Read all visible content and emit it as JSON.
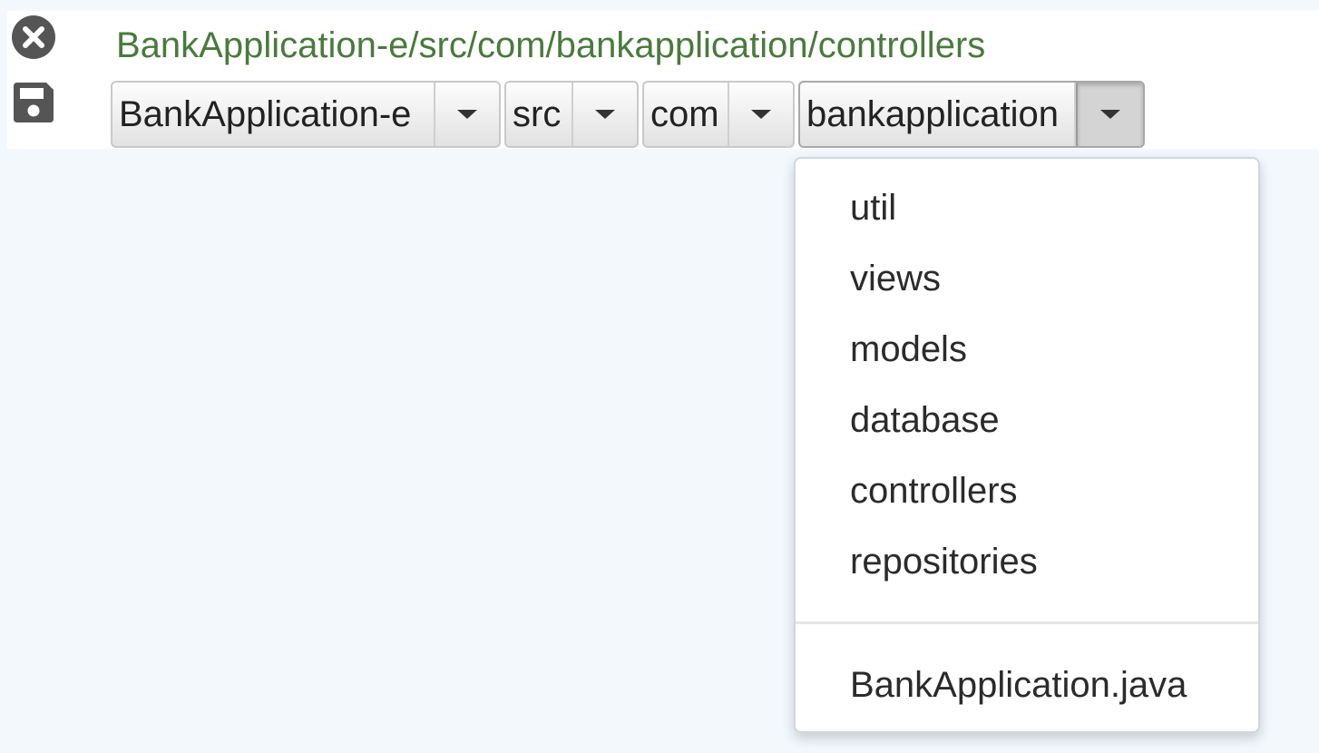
{
  "toolbar": {
    "close_icon": "close-circle-icon",
    "save_icon": "floppy-disk-icon",
    "path": "BankApplication-e/src/com/bankapplication/controllers"
  },
  "breadcrumbs": [
    {
      "label": "BankApplication-e"
    },
    {
      "label": "src"
    },
    {
      "label": "com"
    },
    {
      "label": "bankapplication"
    }
  ],
  "dropdown": {
    "folders": [
      "util",
      "views",
      "models",
      "database",
      "controllers",
      "repositories"
    ],
    "files": [
      "BankApplication.java"
    ]
  },
  "colors": {
    "path_text": "#4a7a3d",
    "page_background": "#f3f8fd"
  }
}
